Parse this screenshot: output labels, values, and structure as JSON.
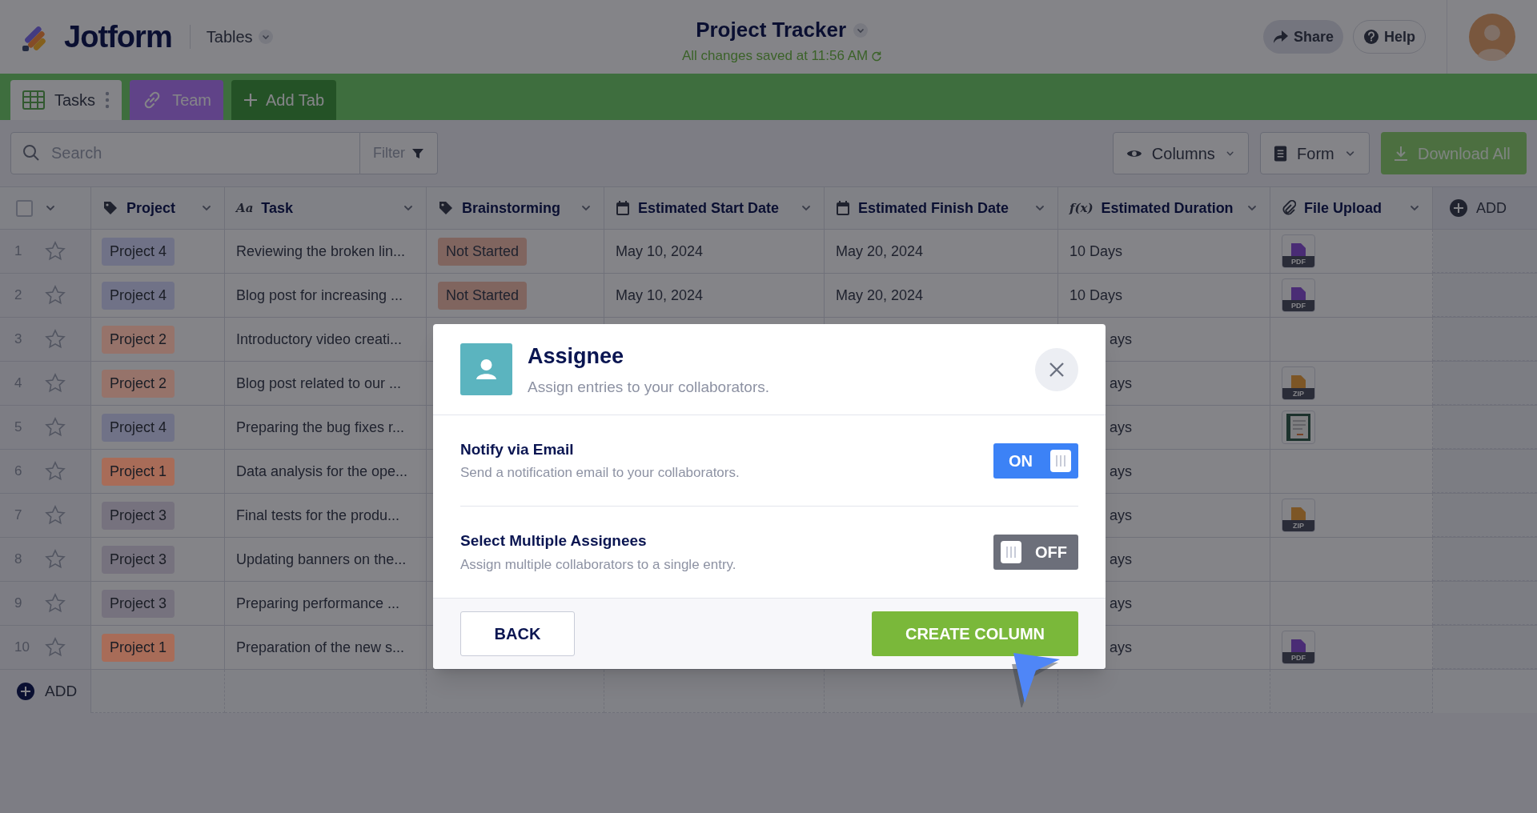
{
  "header": {
    "logo": "Jotform",
    "app_menu": "Tables",
    "title": "Project Tracker",
    "save_status": "All changes saved at 11:56 AM",
    "buttons": [
      "Share",
      "Help"
    ]
  },
  "tabs": [
    {
      "label": "Tasks",
      "kind": "table",
      "selected": true
    },
    {
      "label": "Team",
      "kind": "link",
      "selected": false
    }
  ],
  "add_tab": "Add Tab",
  "toolbar": {
    "search": {
      "placeholder": "Search"
    },
    "filter": "Filter",
    "columns": "Columns",
    "form": "Form",
    "download": "Download All"
  },
  "table": {
    "select_all": {
      "checked": false
    },
    "columns": [
      {
        "label": "Project",
        "kind": "tag"
      },
      {
        "label": "Task",
        "kind": "text",
        "icon_text": "Aa"
      },
      {
        "label": "Brainstorming",
        "kind": "tag"
      },
      {
        "label": "Estimated Start Date",
        "kind": "date"
      },
      {
        "label": "Estimated Finish Date",
        "kind": "date"
      },
      {
        "label": "Estimated Duration",
        "kind": "formula",
        "icon_text": "f(x)"
      },
      {
        "label": "File Upload",
        "kind": "file"
      }
    ],
    "add_column": "ADD",
    "rows": [
      {
        "number": "1",
        "project": {
          "text": "Project 4",
          "color": "#707287"
        },
        "task": "Reviewing the broken lin...",
        "status": "Not Started",
        "start": "May 10, 2024",
        "finish": "May 20, 2024",
        "duration": "10 Days",
        "file": {
          "kind": "pdf",
          "label": "PDF"
        }
      },
      {
        "number": "2",
        "project": {
          "text": "Project 4",
          "color": "#707287"
        },
        "task": "Blog post for increasing ...",
        "status": "Not Started",
        "start": "May 10, 2024",
        "finish": "May 20, 2024",
        "duration": "10 Days",
        "file": {
          "kind": "pdf",
          "label": "PDF"
        }
      },
      {
        "number": "3",
        "project": {
          "text": "Project 2",
          "color": "#96736a"
        },
        "task": "Introductory video creati...",
        "duration": "ays"
      },
      {
        "number": "4",
        "project": {
          "text": "Project 2",
          "color": "#96736a"
        },
        "task": "Blog post related to our ...",
        "duration": "ays",
        "file": {
          "kind": "zip",
          "label": "ZIP"
        }
      },
      {
        "number": "5",
        "project": {
          "text": "Project 4",
          "color": "#707287"
        },
        "task": "Preparing the bug fixes r...",
        "duration": "ays",
        "file": {
          "kind": "image"
        }
      },
      {
        "number": "6",
        "project": {
          "text": "Project 1",
          "color": "#a86c58"
        },
        "task": "Data analysis for the ope...",
        "duration": "ays"
      },
      {
        "number": "7",
        "project": {
          "text": "Project 3",
          "color": "#76727e"
        },
        "task": "Final tests for the produ...",
        "duration": "ays",
        "file": {
          "kind": "zip",
          "label": "ZIP"
        }
      },
      {
        "number": "8",
        "project": {
          "text": "Project 3",
          "color": "#76727e"
        },
        "task": "Updating banners on the...",
        "duration": "ays"
      },
      {
        "number": "9",
        "project": {
          "text": "Project 3",
          "color": "#76727e"
        },
        "task": "Preparing performance ...",
        "duration": "ays"
      },
      {
        "number": "10",
        "project": {
          "text": "Project 1",
          "color": "#a86c58"
        },
        "task": "Preparation of the new s...",
        "duration": "ays",
        "file": {
          "kind": "pdf",
          "label": "PDF"
        }
      }
    ],
    "add_row": "ADD"
  },
  "dialog": {
    "title": "Assignee",
    "subtitle": "Assign entries to your collaborators.",
    "settings": [
      {
        "title": "Notify via Email",
        "description": "Send a notification email to your collaborators.",
        "on": true,
        "toggle_label": "ON"
      },
      {
        "title": "Select Multiple Assignees",
        "description": "Assign multiple collaborators to a single entry.",
        "on": false,
        "toggle_label": "OFF"
      }
    ],
    "back": "BACK",
    "create": "CREATE COLUMN"
  }
}
